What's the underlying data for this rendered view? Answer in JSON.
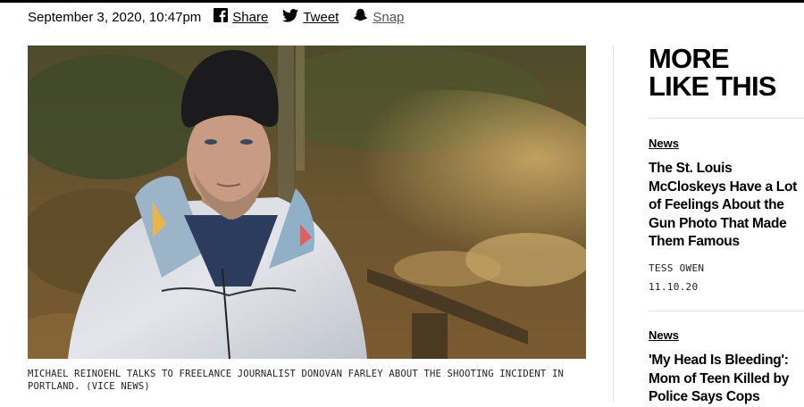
{
  "article": {
    "date": "September 3, 2020, 10:47pm",
    "share": [
      {
        "label": "Share",
        "icon": "facebook-icon"
      },
      {
        "label": "Tweet",
        "icon": "twitter-icon"
      },
      {
        "label": "Snap",
        "icon": "snapchat-icon"
      }
    ],
    "caption": "MICHAEL REINOEHL TALKS TO FREELANCE JOURNALIST DONOVAN FARLEY ABOUT THE SHOOTING INCIDENT IN PORTLAND. (VICE NEWS)"
  },
  "sidebar": {
    "title_line1": "MORE",
    "title_line2": "LIKE THIS",
    "stories": [
      {
        "tag": "News",
        "headline": "The St. Louis McCloskeys Have a Lot of Feelings About the Gun Photo That Made Them Famous",
        "author": "TESS OWEN",
        "date": "11.10.20"
      },
      {
        "tag": "News",
        "headline": "'My Head Is Bleeding': Mom of Teen Killed by Police Says Cops"
      }
    ]
  }
}
